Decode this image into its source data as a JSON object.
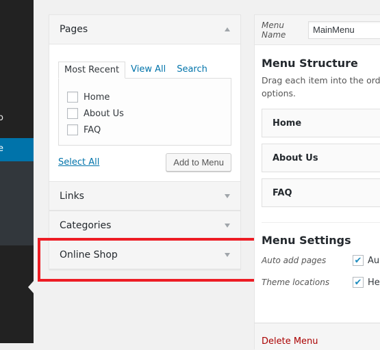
{
  "sidebar": {
    "fragment_above": "o",
    "active_fragment": "e"
  },
  "left": {
    "pages_title": "Pages",
    "tabs": [
      "Most Recent",
      "View All",
      "Search"
    ],
    "pages": [
      "Home",
      "About Us",
      "FAQ"
    ],
    "select_all": "Select All",
    "add_button": "Add to Menu",
    "sections": [
      "Links",
      "Categories",
      "Online Shop"
    ]
  },
  "right": {
    "menu_name_label": "Menu Name",
    "menu_name_value": "MainMenu",
    "structure_title": "Menu Structure",
    "structure_desc_1": "Drag each item into the orde",
    "structure_desc_2": "options.",
    "items": [
      "Home",
      "About Us",
      "FAQ"
    ],
    "settings_title": "Menu Settings",
    "auto_add_label": "Auto add pages",
    "auto_add_value": "Au",
    "theme_label": "Theme locations",
    "theme_value": "He",
    "delete_label": "Delete Menu"
  },
  "colors": {
    "accent": "#0073aa",
    "highlight": "#ed1c24",
    "delete": "#aa0000"
  }
}
